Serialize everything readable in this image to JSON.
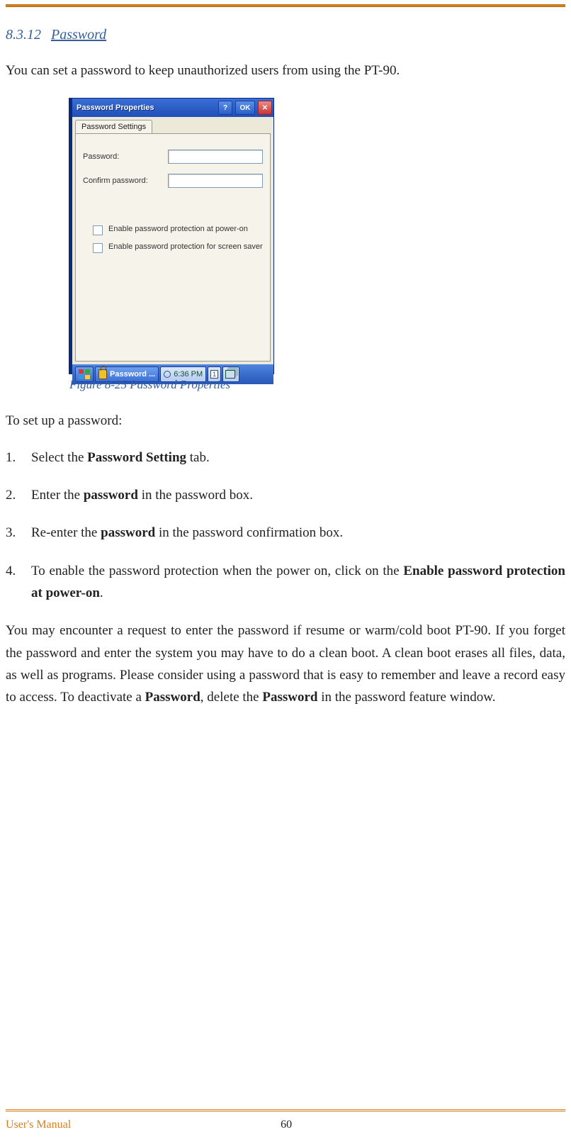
{
  "section": {
    "number": "8.3.12",
    "title": "Password"
  },
  "intro": "You can set a password to keep unauthorized users from using the PT-90.",
  "dialog": {
    "title": "Password Properties",
    "help_btn": "?",
    "ok_btn": "OK",
    "close_btn": "✕",
    "tab": "Password Settings",
    "field_password": "Password:",
    "field_confirm": "Confirm password:",
    "check_poweron": "Enable password protection at power-on",
    "check_screensaver": "Enable password protection for screen saver",
    "taskbar_app": "Password ...",
    "taskbar_clock": "6:36 PM",
    "kbd_indicator": "1"
  },
  "figure_caption": "Figure 8-25 Password Properties",
  "setup_intro": "To set up a password:",
  "steps": [
    {
      "pre": "Select the ",
      "b1": "Password Setting",
      "post": " tab."
    },
    {
      "pre": "Enter the ",
      "b1": "password",
      "post": " in the password box."
    },
    {
      "pre": "Re-enter the ",
      "b1": "password",
      "post": " in the password confirmation box."
    },
    {
      "pre": "To enable the password protection when the power on, click on the ",
      "b1": "Enable password protection at power-on",
      "post": "."
    }
  ],
  "note": {
    "p1": "You may encounter a request to enter the password if resume or warm/cold boot PT-90. If you forget the password and enter the system you may have to do a clean boot. A clean boot erases all files, data, as well as programs. Please consider using a password that is easy to remember and leave a record easy to access. To deactivate a ",
    "b1": "Password",
    "p2": ", delete the ",
    "b2": "Password",
    "p3": " in the password feature window."
  },
  "footer": {
    "left": "User's Manual",
    "page": "60"
  }
}
